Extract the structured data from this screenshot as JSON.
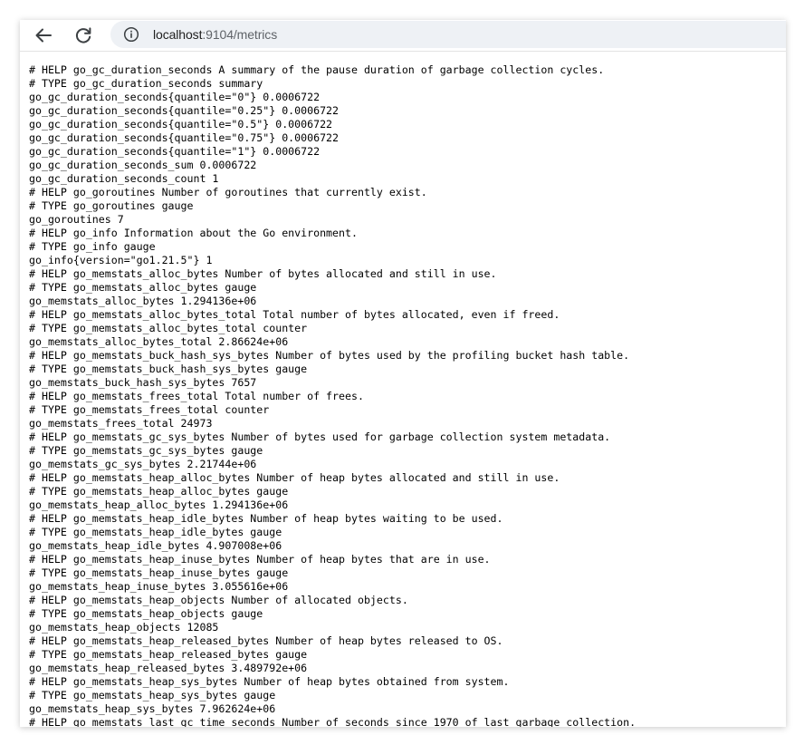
{
  "browser": {
    "url_host": "localhost",
    "url_port_path": ":9104/metrics"
  },
  "icons": {
    "back": "back-arrow-icon",
    "reload": "reload-icon",
    "info": "info-icon"
  },
  "metrics_lines": [
    "# HELP go_gc_duration_seconds A summary of the pause duration of garbage collection cycles.",
    "# TYPE go_gc_duration_seconds summary",
    "go_gc_duration_seconds{quantile=\"0\"} 0.0006722",
    "go_gc_duration_seconds{quantile=\"0.25\"} 0.0006722",
    "go_gc_duration_seconds{quantile=\"0.5\"} 0.0006722",
    "go_gc_duration_seconds{quantile=\"0.75\"} 0.0006722",
    "go_gc_duration_seconds{quantile=\"1\"} 0.0006722",
    "go_gc_duration_seconds_sum 0.0006722",
    "go_gc_duration_seconds_count 1",
    "# HELP go_goroutines Number of goroutines that currently exist.",
    "# TYPE go_goroutines gauge",
    "go_goroutines 7",
    "# HELP go_info Information about the Go environment.",
    "# TYPE go_info gauge",
    "go_info{version=\"go1.21.5\"} 1",
    "# HELP go_memstats_alloc_bytes Number of bytes allocated and still in use.",
    "# TYPE go_memstats_alloc_bytes gauge",
    "go_memstats_alloc_bytes 1.294136e+06",
    "# HELP go_memstats_alloc_bytes_total Total number of bytes allocated, even if freed.",
    "# TYPE go_memstats_alloc_bytes_total counter",
    "go_memstats_alloc_bytes_total 2.86624e+06",
    "# HELP go_memstats_buck_hash_sys_bytes Number of bytes used by the profiling bucket hash table.",
    "# TYPE go_memstats_buck_hash_sys_bytes gauge",
    "go_memstats_buck_hash_sys_bytes 7657",
    "# HELP go_memstats_frees_total Total number of frees.",
    "# TYPE go_memstats_frees_total counter",
    "go_memstats_frees_total 24973",
    "# HELP go_memstats_gc_sys_bytes Number of bytes used for garbage collection system metadata.",
    "# TYPE go_memstats_gc_sys_bytes gauge",
    "go_memstats_gc_sys_bytes 2.21744e+06",
    "# HELP go_memstats_heap_alloc_bytes Number of heap bytes allocated and still in use.",
    "# TYPE go_memstats_heap_alloc_bytes gauge",
    "go_memstats_heap_alloc_bytes 1.294136e+06",
    "# HELP go_memstats_heap_idle_bytes Number of heap bytes waiting to be used.",
    "# TYPE go_memstats_heap_idle_bytes gauge",
    "go_memstats_heap_idle_bytes 4.907008e+06",
    "# HELP go_memstats_heap_inuse_bytes Number of heap bytes that are in use.",
    "# TYPE go_memstats_heap_inuse_bytes gauge",
    "go_memstats_heap_inuse_bytes 3.055616e+06",
    "# HELP go_memstats_heap_objects Number of allocated objects.",
    "# TYPE go_memstats_heap_objects gauge",
    "go_memstats_heap_objects 12085",
    "# HELP go_memstats_heap_released_bytes Number of heap bytes released to OS.",
    "# TYPE go_memstats_heap_released_bytes gauge",
    "go_memstats_heap_released_bytes 3.489792e+06",
    "# HELP go_memstats_heap_sys_bytes Number of heap bytes obtained from system.",
    "# TYPE go_memstats_heap_sys_bytes gauge",
    "go_memstats_heap_sys_bytes 7.962624e+06",
    "# HELP go_memstats_last_gc_time_seconds Number of seconds since 1970 of last garbage collection."
  ]
}
